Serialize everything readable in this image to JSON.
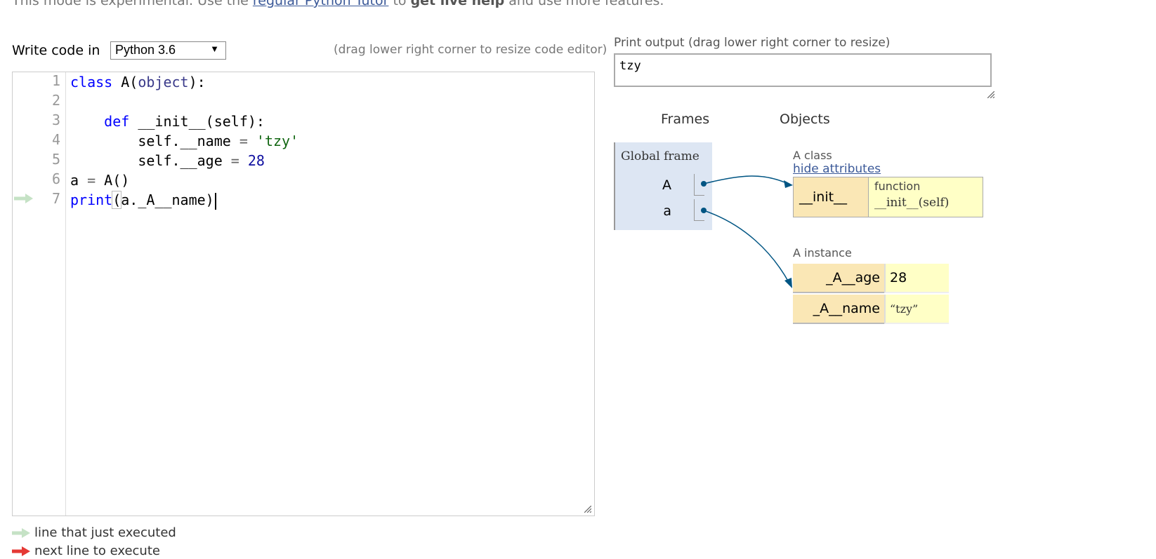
{
  "notice": {
    "prefix": "This mode is experimental. Use the ",
    "link": "regular Python Tutor",
    "middle": " to ",
    "bold": "get live help",
    "suffix": " and use more features."
  },
  "editor": {
    "write_label": "Write code in",
    "language": "Python 3.6",
    "drag_hint": "(drag lower right corner to resize code editor)",
    "line_numbers": [
      "1",
      "2",
      "3",
      "4",
      "5",
      "6",
      "7"
    ],
    "current_line": 7
  },
  "code": {
    "l1_kw": "class",
    "l1_name": " A(",
    "l1_base": "object",
    "l1_end": "):",
    "l3_kw": "def",
    "l3_rest": " __init__(self):",
    "l4_lhs": "self.__name ",
    "l4_eq": "=",
    "l4_val": " 'tzy'",
    "l5_lhs": "self.__age ",
    "l5_eq": "=",
    "l5_val": " 28",
    "l6_lhs": "a ",
    "l6_eq": "=",
    "l6_rhs": " A()",
    "l7_fn": "print",
    "l7_open": "(",
    "l7_arg": "a._A__name)"
  },
  "legend": {
    "just_executed": "line that just executed",
    "next_line": "next line to execute",
    "just_executed_color": "#c5e2c5",
    "next_line_color": "#e53935"
  },
  "output": {
    "label": "Print output (drag lower right corner to resize)",
    "text": "tzy"
  },
  "visualizer": {
    "frames_header": "Frames",
    "objects_header": "Objects",
    "global_frame_title": "Global frame",
    "vars": [
      "A",
      "a"
    ],
    "class_label": "A class",
    "hide_attributes": "hide attributes",
    "class_attr_key": "__init__",
    "class_attr_type": "function",
    "class_attr_sig": "__init__(self)",
    "instance_label": "A instance",
    "instance_attrs": [
      {
        "key": "_A__age",
        "value": "28"
      },
      {
        "key": "_A__name",
        "value": "“tzy”"
      }
    ],
    "arrow_color": "#005583"
  }
}
